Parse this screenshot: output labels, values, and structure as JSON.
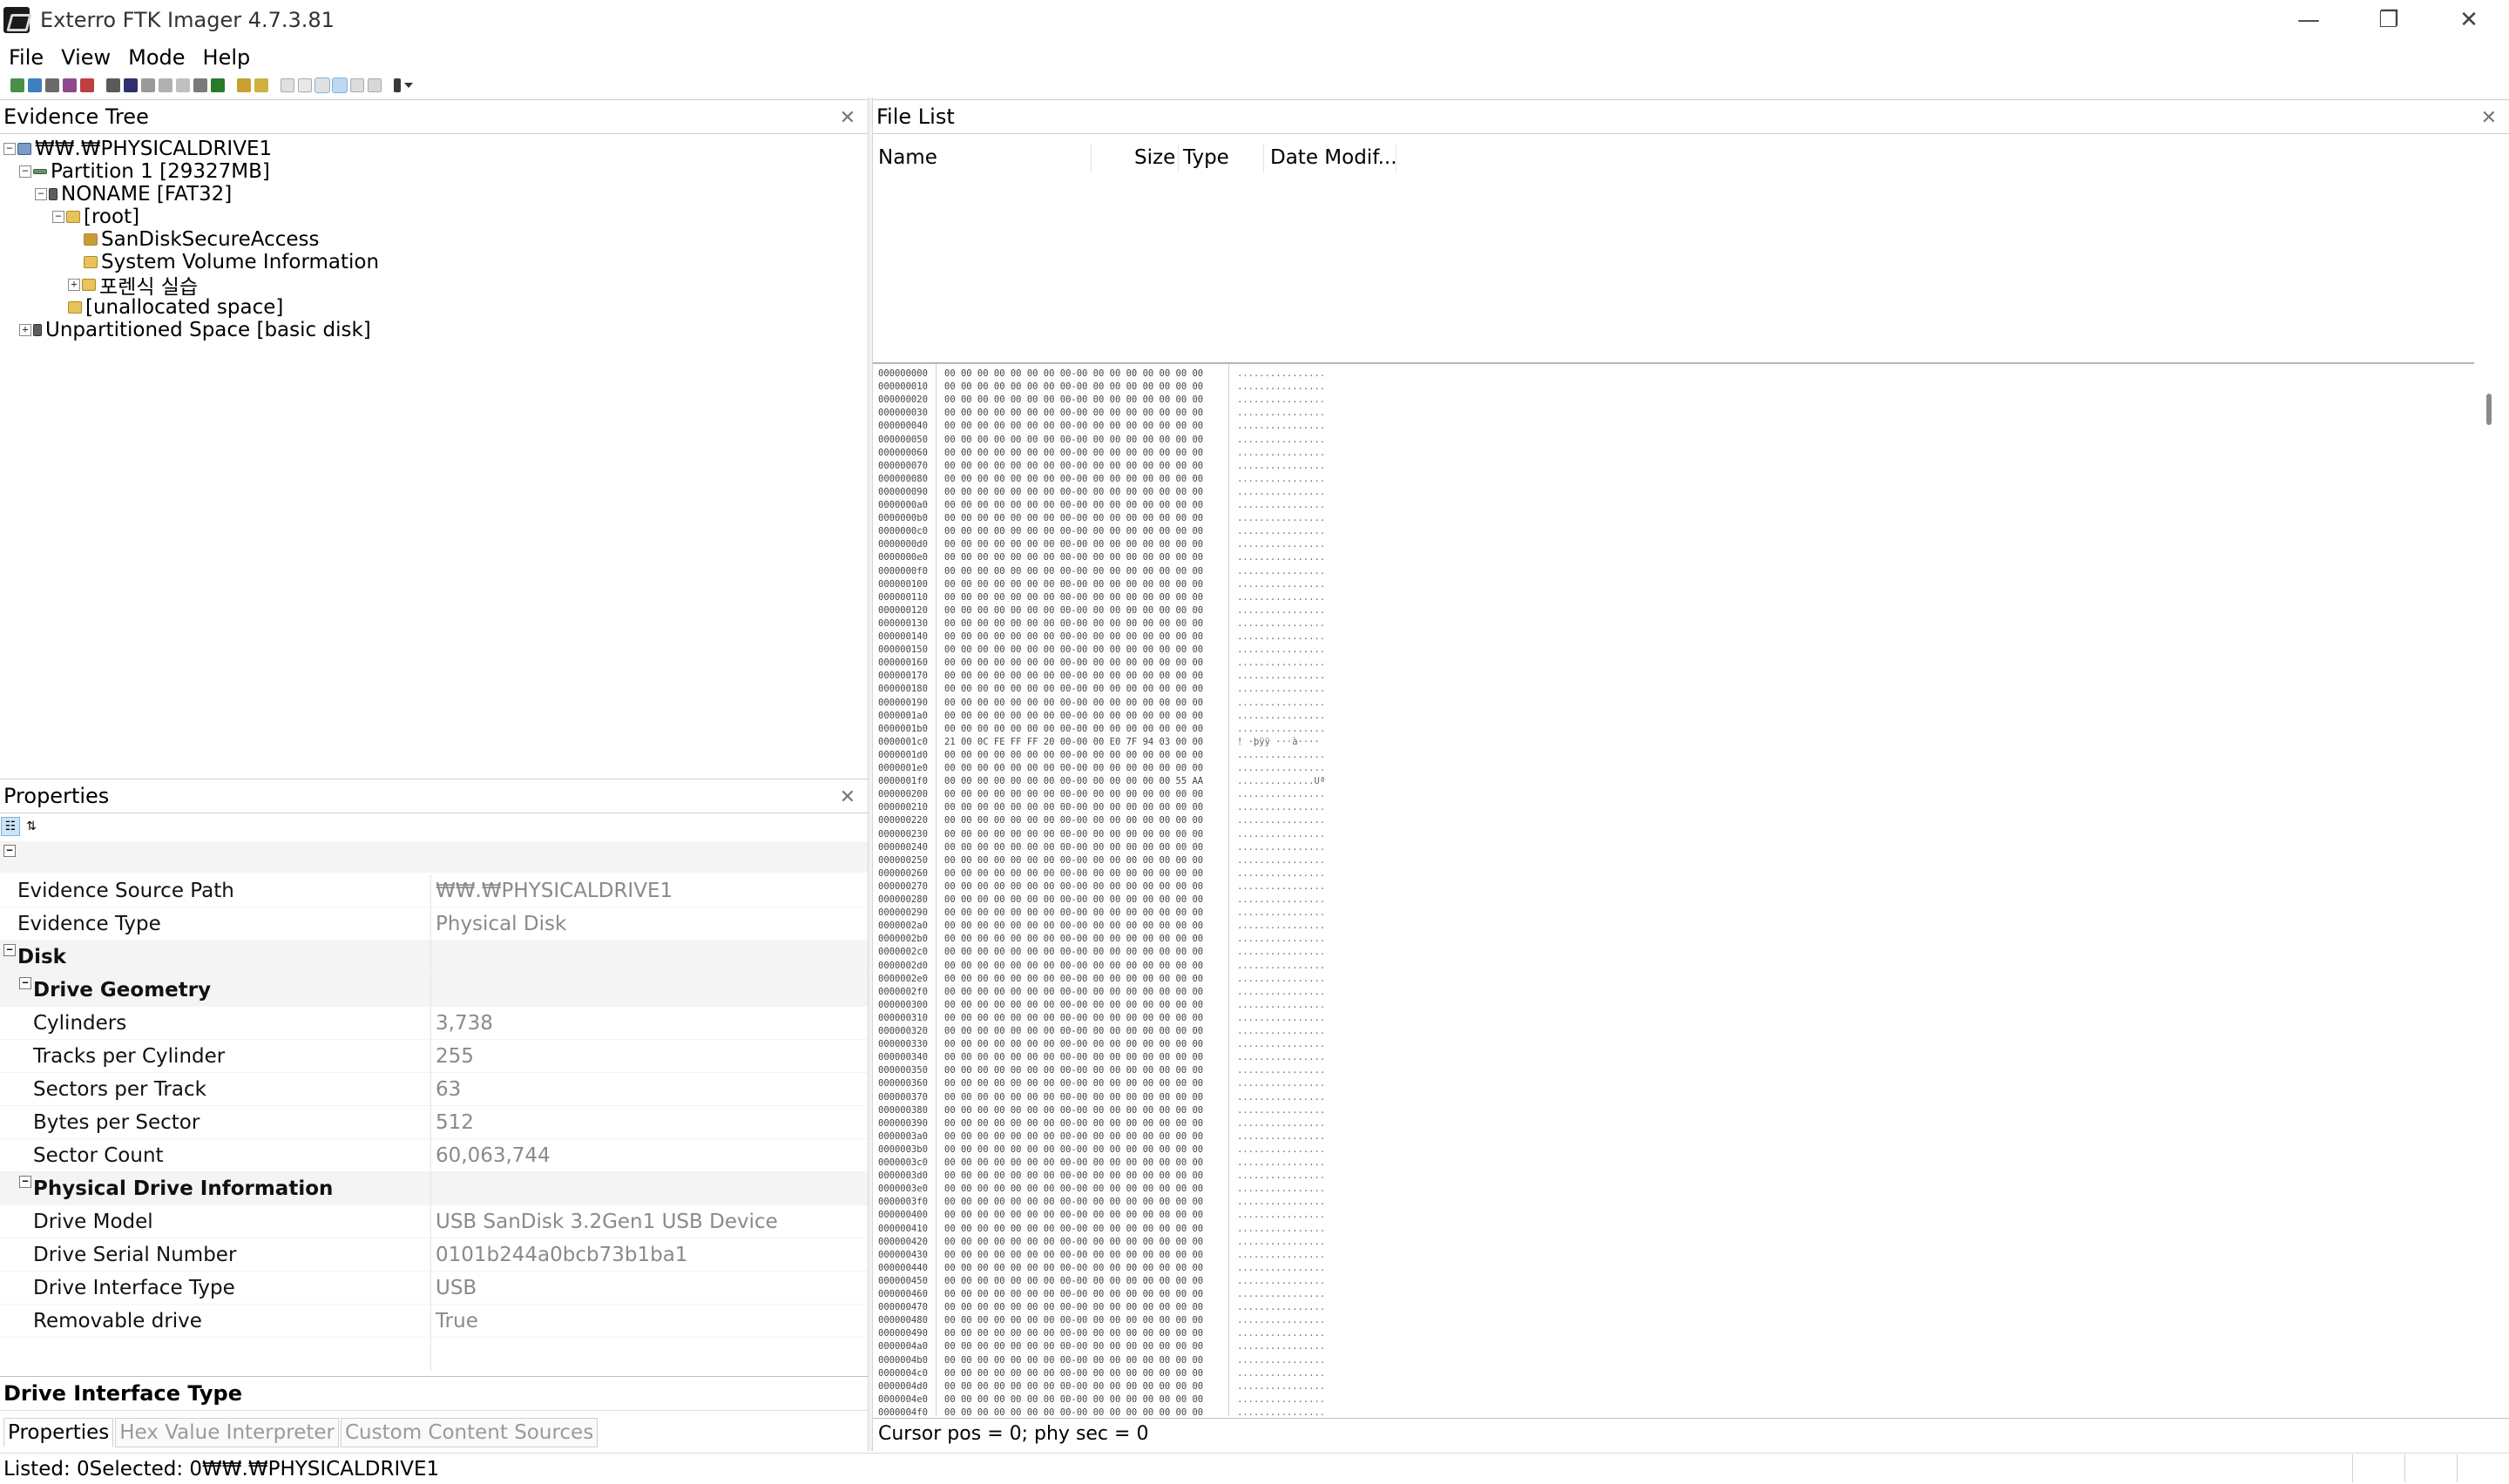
{
  "window": {
    "title": "Exterro FTK Imager 4.7.3.81",
    "minimize": "—",
    "restore": "❐",
    "close": "✕"
  },
  "menu": [
    "File",
    "View",
    "Mode",
    "Help"
  ],
  "evidence_tree": {
    "title": "Evidence Tree",
    "close": "✕",
    "nodes": [
      {
        "label": "₩₩.₩PHYSICALDRIVE1",
        "toggle": "−"
      },
      {
        "label": "Partition 1 [29327MB]",
        "toggle": "−"
      },
      {
        "label": "NONAME [FAT32]",
        "toggle": "−"
      },
      {
        "label": "[root]",
        "toggle": "−"
      },
      {
        "label": "SanDiskSecureAccess",
        "toggle": ""
      },
      {
        "label": "System Volume Information",
        "toggle": ""
      },
      {
        "label": "포렌식 실습",
        "toggle": "+"
      },
      {
        "label": "[unallocated space]",
        "toggle": ""
      },
      {
        "label": "Unpartitioned Space [basic disk]",
        "toggle": "+"
      }
    ]
  },
  "properties": {
    "title": "Properties",
    "close": "✕",
    "rows": [
      {
        "key": "Evidence Source Path",
        "value": "₩₩.₩PHYSICALDRIVE1"
      },
      {
        "key": "Evidence Type",
        "value": "Physical Disk"
      },
      {
        "key": "Disk",
        "value": "",
        "category": true
      },
      {
        "key": "Drive Geometry",
        "value": "",
        "category": true
      },
      {
        "key": "Cylinders",
        "value": "3,738"
      },
      {
        "key": "Tracks per Cylinder",
        "value": "255"
      },
      {
        "key": "Sectors per Track",
        "value": "63"
      },
      {
        "key": "Bytes per Sector",
        "value": "512"
      },
      {
        "key": "Sector Count",
        "value": "60,063,744"
      },
      {
        "key": "Physical Drive Information",
        "value": "",
        "category": true
      },
      {
        "key": "Drive Model",
        "value": " USB  SanDisk 3.2Gen1 USB Device"
      },
      {
        "key": "Drive Serial Number",
        "value": "0101b244a0bcb73b1ba1"
      },
      {
        "key": "Drive Interface Type",
        "value": "USB"
      },
      {
        "key": "Removable drive",
        "value": "True"
      }
    ],
    "description_title": "Drive Interface Type",
    "tabs": [
      "Properties",
      "Hex Value Interpreter",
      "Custom Content Sources"
    ]
  },
  "file_list": {
    "title": "File List",
    "close": "✕",
    "columns": [
      "Name",
      "Size",
      "Type",
      "Date Modif..."
    ]
  },
  "hex_viewer": {
    "cursor_info": "Cursor pos = 0; phy sec = 0",
    "zero_bytes": "00 00 00 00 00 00 00 00-00 00 00 00 00 00 00 00",
    "zero_ascii": "................",
    "special_rows": [
      {
        "offset": "0000001c0",
        "bytes": "21 00 0C FE FF FF 20 00-00 00 E0 7F 94 03 00 00",
        "ascii": "! ·þÿÿ ···à····"
      },
      {
        "offset": "0000001f0",
        "bytes": "00 00 00 00 00 00 00 00-00 00 00 00 00 00 55 AA",
        "ascii": "..............Uª"
      }
    ]
  },
  "status": {
    "text": "Listed: 0Selected: 0₩₩.₩PHYSICALDRIVE1"
  },
  "colors": {
    "accent": "#cce4f7",
    "border": "#cfcfcf",
    "value_text": "#8a8a8a"
  }
}
